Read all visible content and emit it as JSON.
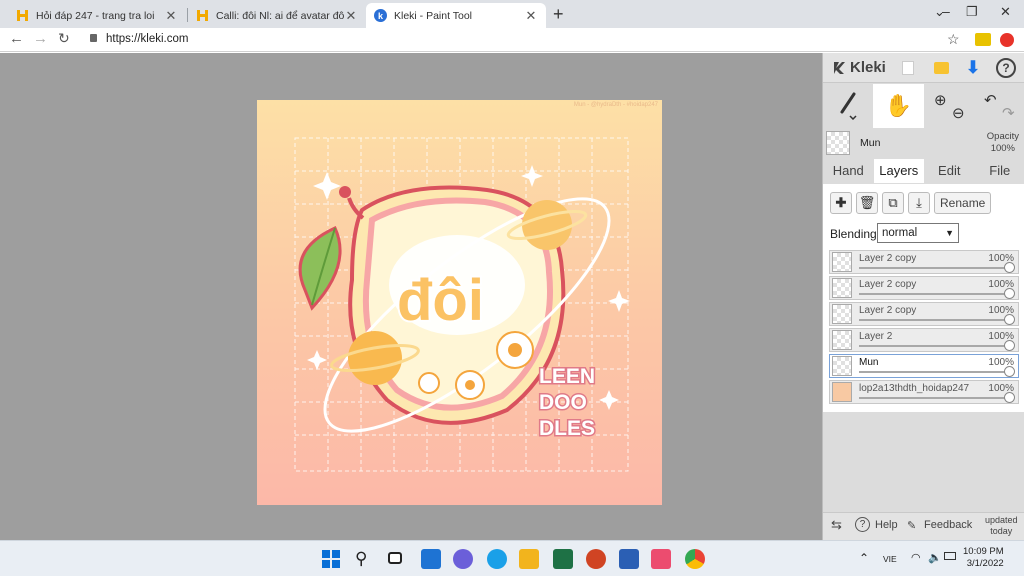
{
  "browser": {
    "tabs": [
      {
        "title": "Hỏi đáp 247 - trang tra loi"
      },
      {
        "title": "Calli: đôi Nl: ai để avatar đôi zới t"
      },
      {
        "title": "Kleki - Paint Tool"
      }
    ],
    "url": "https://kleki.com"
  },
  "kleki": {
    "logo": "Kleki",
    "current_layer": {
      "name": "Mun",
      "opacity_label": "Opacity",
      "opacity_value": "100%"
    },
    "tabs": [
      "Hand",
      "Layers",
      "Edit",
      "File"
    ],
    "active_tab": "Layers",
    "rename_label": "Rename",
    "blending_label": "Blending",
    "blending_value": "normal",
    "layers": [
      {
        "name": "Layer 2 copy",
        "opacity": "100%"
      },
      {
        "name": "Layer 2 copy",
        "opacity": "100%"
      },
      {
        "name": "Layer 2 copy",
        "opacity": "100%"
      },
      {
        "name": "Layer 2",
        "opacity": "100%"
      },
      {
        "name": "Mun",
        "opacity": "100%"
      },
      {
        "name": "lop2a13thdth_hoidap247",
        "opacity": "100%"
      }
    ],
    "bottom": {
      "help": "Help",
      "feedback": "Feedback",
      "updated": "updated\ntoday"
    }
  },
  "artwork": {
    "signature": "Mun - @hydraDth - #hoidap247",
    "word": "đôi",
    "brand_lines": [
      "LEEN",
      "DOO",
      "DLES"
    ]
  },
  "taskbar": {
    "lang": "VIE",
    "time": "10:09 PM",
    "date": "3/1/2022"
  },
  "colors": {
    "accent_blue": "#1a73e8",
    "kleki_sidebar": "#dcdcdc",
    "canvas_bg": "#9e9e9e"
  }
}
